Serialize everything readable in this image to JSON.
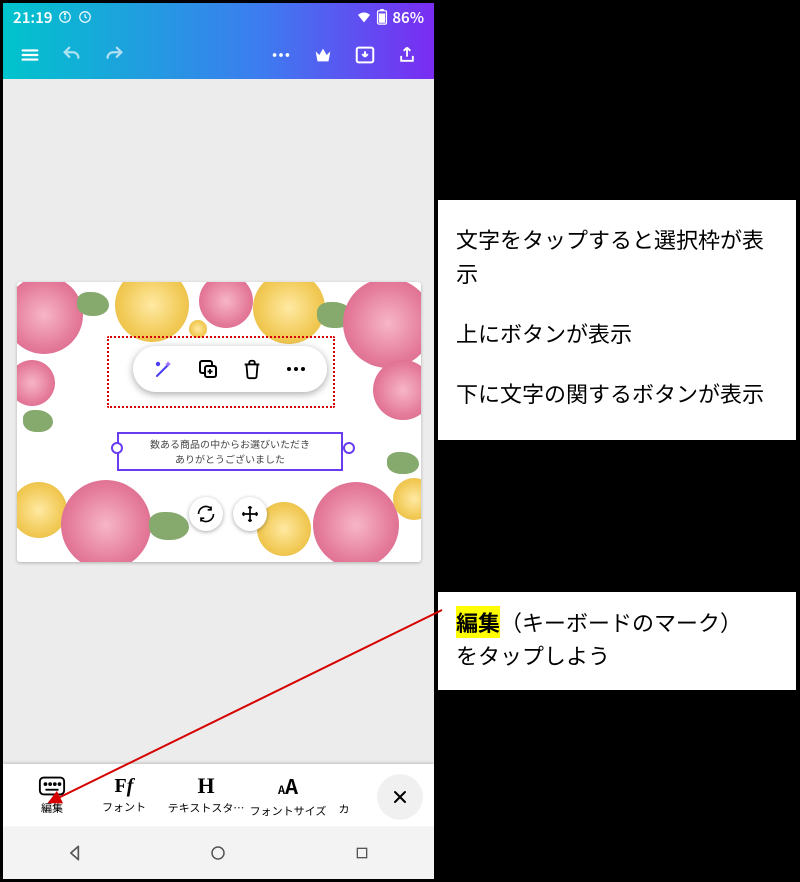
{
  "status": {
    "time": "21:19",
    "battery": "86%"
  },
  "popup_icons": {
    "wand": "wand-icon",
    "dup": "duplicate-icon",
    "trash": "trash-icon",
    "more": "more-icon"
  },
  "textbox": {
    "line1": "数ある商品の中からお選びいただき",
    "line2": "ありがとうございました"
  },
  "tools": {
    "edit": "編集",
    "font": "フォント",
    "style": "テキストスタ…",
    "size": "フォントサイズ",
    "extra": "カ"
  },
  "instructions": {
    "p1": "文字をタップすると選択枠が表示",
    "p2": "上にボタンが表示",
    "p3": "下に文字の関するボタンが表示",
    "hl": "編集",
    "p4a": "（キーボードのマーク）",
    "p4b": "をタップしよう"
  }
}
